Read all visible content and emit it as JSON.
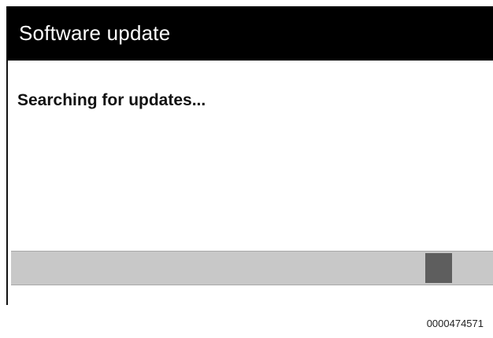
{
  "window": {
    "title": "Software update"
  },
  "status": {
    "message": "Searching for updates..."
  },
  "progress": {
    "indicator_position": 0.86,
    "mode": "indeterminate"
  },
  "caption": {
    "code": "0000474571"
  },
  "colors": {
    "titlebar_bg": "#000000",
    "titlebar_text": "#ffffff",
    "track": "#c8c8c8",
    "indicator": "#5e5e5e"
  }
}
